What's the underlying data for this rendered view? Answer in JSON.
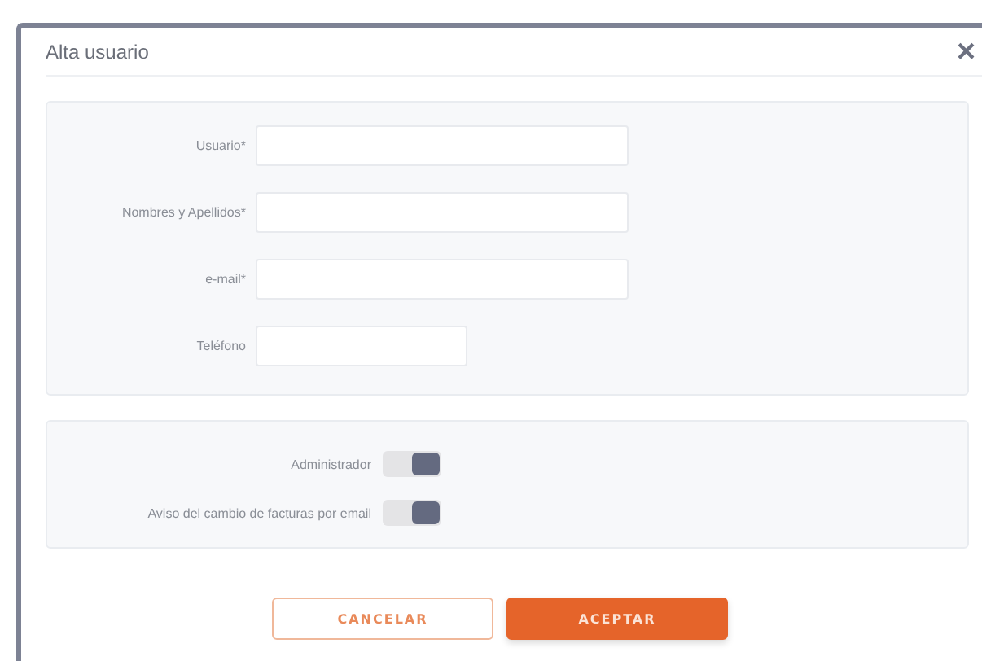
{
  "window": {
    "title": "Alta usuario",
    "close": "×"
  },
  "fields": [
    {
      "label": "Usuario*",
      "kind": "text"
    },
    {
      "label": "Nombres y Apellidos*",
      "kind": "text"
    },
    {
      "label": "e-mail*",
      "kind": "email"
    },
    {
      "label": "Teléfono",
      "kind": "phone"
    }
  ],
  "toggles": [
    {
      "label": "Administrador",
      "on": true
    },
    {
      "label": "Aviso del cambio de facturas por email",
      "on": true
    }
  ],
  "buttons": [
    {
      "label": "CANCELAR",
      "kind": "secondary"
    },
    {
      "label": "ACEPTAR",
      "kind": "primary"
    }
  ]
}
